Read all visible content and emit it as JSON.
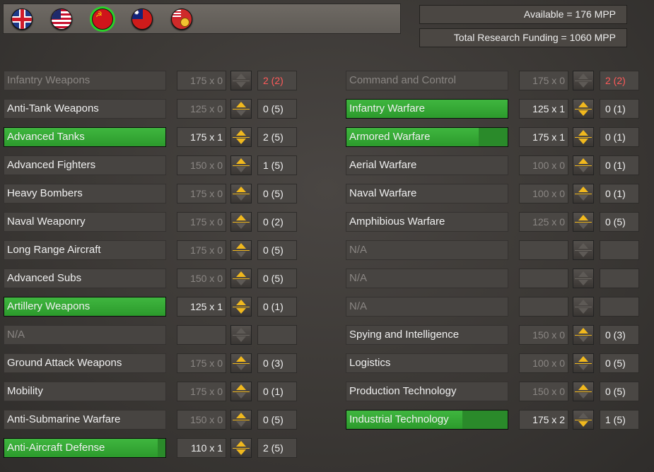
{
  "flags": [
    {
      "icon": "uk-flag-icon",
      "cls": "flag-uk",
      "selected": false
    },
    {
      "icon": "usa-flag-icon",
      "cls": "flag-us",
      "selected": false
    },
    {
      "icon": "ussr-flag-icon",
      "cls": "flag-ussr",
      "selected": true
    },
    {
      "icon": "china-flag-icon",
      "cls": "flag-china",
      "selected": false
    },
    {
      "icon": "nation-flag-icon",
      "cls": "flag-other",
      "selected": false
    }
  ],
  "header": {
    "available": "Available = 176 MPP",
    "funding": "Total Research Funding = 1060 MPP"
  },
  "colors": {
    "accent_arrow": "#f0b81e",
    "progress_green": "#3fb63f",
    "warning_red": "#ff5a5a",
    "selected_ring": "#2ad02a"
  },
  "left_column": [
    {
      "name": "Infantry Weapons",
      "cost": "175 x 0",
      "level": "2 (2)",
      "state": "dim",
      "up": false,
      "down": false,
      "progress": 0,
      "level_red": true
    },
    {
      "name": "Anti-Tank Weapons",
      "cost": "125 x 0",
      "level": "0 (5)",
      "state": "normal",
      "up": true,
      "down": false,
      "progress": 0
    },
    {
      "name": "Advanced Tanks",
      "cost": "175 x 1",
      "level": "2 (5)",
      "state": "researched",
      "up": true,
      "down": true,
      "progress": 1.0
    },
    {
      "name": "Advanced Fighters",
      "cost": "150 x 0",
      "level": "1 (5)",
      "state": "normal",
      "up": true,
      "down": false,
      "progress": 0
    },
    {
      "name": "Heavy Bombers",
      "cost": "175 x 0",
      "level": "0 (5)",
      "state": "normal",
      "up": true,
      "down": false,
      "progress": 0
    },
    {
      "name": "Naval Weaponry",
      "cost": "175 x 0",
      "level": "0 (2)",
      "state": "normal",
      "up": true,
      "down": false,
      "progress": 0
    },
    {
      "name": "Long Range Aircraft",
      "cost": "175 x 0",
      "level": "0 (5)",
      "state": "normal",
      "up": true,
      "down": false,
      "progress": 0
    },
    {
      "name": "Advanced Subs",
      "cost": "150 x 0",
      "level": "0 (5)",
      "state": "normal",
      "up": true,
      "down": false,
      "progress": 0
    },
    {
      "name": "Artillery Weapons",
      "cost": "125 x 1",
      "level": "0 (1)",
      "state": "researched",
      "up": true,
      "down": true,
      "progress": 1.0
    },
    {
      "name": "N/A",
      "cost": "",
      "level": "",
      "state": "dim",
      "up": false,
      "down": false,
      "progress": 0
    },
    {
      "name": "Ground Attack Weapons",
      "cost": "175 x 0",
      "level": "0 (3)",
      "state": "normal",
      "up": true,
      "down": false,
      "progress": 0
    },
    {
      "name": "Mobility",
      "cost": "175 x 0",
      "level": "0 (1)",
      "state": "normal",
      "up": true,
      "down": false,
      "progress": 0
    },
    {
      "name": "Anti-Submarine Warfare",
      "cost": "150 x 0",
      "level": "0 (5)",
      "state": "normal",
      "up": true,
      "down": false,
      "progress": 0
    },
    {
      "name": "Anti-Aircraft Defense",
      "cost": "110 x 1",
      "level": "2 (5)",
      "state": "researched",
      "up": true,
      "down": true,
      "progress": 0.95
    }
  ],
  "right_column": [
    {
      "name": "Command and Control",
      "cost": "175 x 0",
      "level": "2 (2)",
      "state": "dim",
      "up": false,
      "down": false,
      "progress": 0,
      "level_red": true
    },
    {
      "name": "Infantry Warfare",
      "cost": "125 x 1",
      "level": "0 (1)",
      "state": "researched",
      "up": true,
      "down": true,
      "progress": 1.0
    },
    {
      "name": "Armored Warfare",
      "cost": "175 x 1",
      "level": "0 (1)",
      "state": "researched",
      "up": true,
      "down": true,
      "progress": 0.82
    },
    {
      "name": "Aerial Warfare",
      "cost": "100 x 0",
      "level": "0 (1)",
      "state": "normal",
      "up": true,
      "down": false,
      "progress": 0
    },
    {
      "name": "Naval Warfare",
      "cost": "100 x 0",
      "level": "0 (1)",
      "state": "normal",
      "up": true,
      "down": false,
      "progress": 0
    },
    {
      "name": "Amphibious Warfare",
      "cost": "125 x 0",
      "level": "0 (5)",
      "state": "normal",
      "up": true,
      "down": false,
      "progress": 0
    },
    {
      "name": "N/A",
      "cost": "",
      "level": "",
      "state": "dim",
      "up": false,
      "down": false,
      "progress": 0
    },
    {
      "name": "N/A",
      "cost": "",
      "level": "",
      "state": "dim",
      "up": false,
      "down": false,
      "progress": 0
    },
    {
      "name": "N/A",
      "cost": "",
      "level": "",
      "state": "dim",
      "up": false,
      "down": false,
      "progress": 0
    },
    {
      "name": "Spying and Intelligence",
      "cost": "150 x 0",
      "level": "0 (3)",
      "state": "normal",
      "up": true,
      "down": false,
      "progress": 0
    },
    {
      "name": "Logistics",
      "cost": "100 x 0",
      "level": "0 (5)",
      "state": "normal",
      "up": true,
      "down": false,
      "progress": 0
    },
    {
      "name": "Production Technology",
      "cost": "150 x 0",
      "level": "0 (5)",
      "state": "normal",
      "up": true,
      "down": false,
      "progress": 0
    },
    {
      "name": "Industrial Technology",
      "cost": "175 x 2",
      "level": "1 (5)",
      "state": "researched",
      "up": false,
      "down": true,
      "progress": 0.72
    }
  ]
}
